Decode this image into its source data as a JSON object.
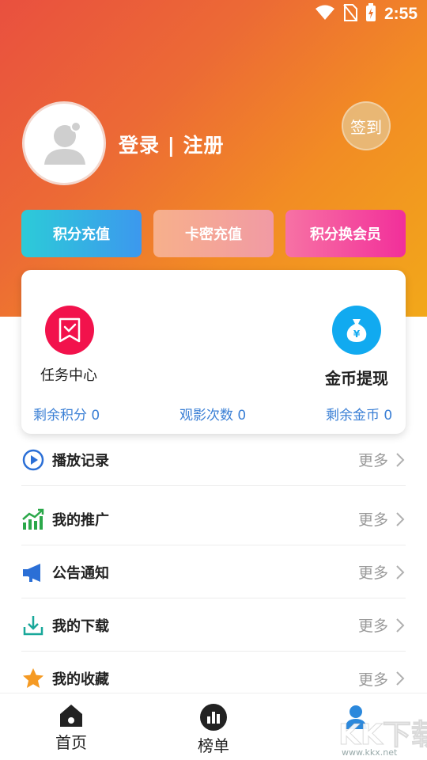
{
  "status_bar": {
    "time": "2:55",
    "icons": [
      "wifi-icon",
      "no-sim-icon",
      "battery-charging-icon"
    ]
  },
  "profile": {
    "login_label": "登录 | 注册",
    "signin_label": "签到"
  },
  "actions": [
    {
      "label": "积分充值"
    },
    {
      "label": "卡密充值"
    },
    {
      "label": "积分换会员"
    }
  ],
  "card": {
    "task_center": "任务中心",
    "coin_withdraw": "金币提现",
    "stats": [
      {
        "text": "剩余积分 0"
      },
      {
        "text": "观影次数 0"
      },
      {
        "text": "剩余金币 0"
      }
    ]
  },
  "menu": {
    "more_label": "更多",
    "items": [
      {
        "label": "播放记录",
        "icon": "play-circle-icon"
      },
      {
        "label": "我的推广",
        "icon": "trend-chart-icon"
      },
      {
        "label": "公告通知",
        "icon": "megaphone-icon"
      },
      {
        "label": "我的下载",
        "icon": "download-icon"
      },
      {
        "label": "我的收藏",
        "icon": "star-icon"
      }
    ]
  },
  "bottom_nav": [
    {
      "label": "首页",
      "icon": "home-icon"
    },
    {
      "label": "榜单",
      "icon": "chart-icon"
    },
    {
      "label": "",
      "icon": "user-icon"
    }
  ],
  "watermark": {
    "text": "www.kkx.net",
    "logo_text": "KK下载"
  },
  "colors": {
    "accent": "#3a7fd5",
    "header_start": "#e9503f",
    "header_end": "#f2a81a"
  }
}
